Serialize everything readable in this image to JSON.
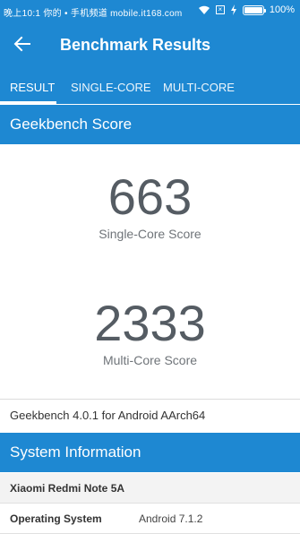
{
  "status_bar": {
    "left_text": "晚上10:1 你的 • 手机频道 mobile.it168.com",
    "battery_level": 1.0,
    "battery_text": "100%"
  },
  "app_bar": {
    "title": "Benchmark Results",
    "back_icon": "arrow-left-icon"
  },
  "tabs": [
    {
      "label": "RESULT",
      "active": true
    },
    {
      "label": "SINGLE-CORE",
      "active": false
    },
    {
      "label": "MULTI-CORE",
      "active": false
    }
  ],
  "geekbench": {
    "header": "Geekbench Score",
    "single_core_score": "663",
    "single_core_label": "Single-Core Score",
    "multi_core_score": "2333",
    "multi_core_label": "Multi-Core Score",
    "version_text": "Geekbench 4.0.1 for Android AArch64"
  },
  "system_info": {
    "header": "System Information",
    "device": "Xiaomi Redmi Note 5A",
    "rows": [
      {
        "key": "Operating System",
        "value": "Android 7.1.2"
      }
    ]
  },
  "colors": {
    "primary": "#1e88d2",
    "score_text": "#555c63"
  }
}
